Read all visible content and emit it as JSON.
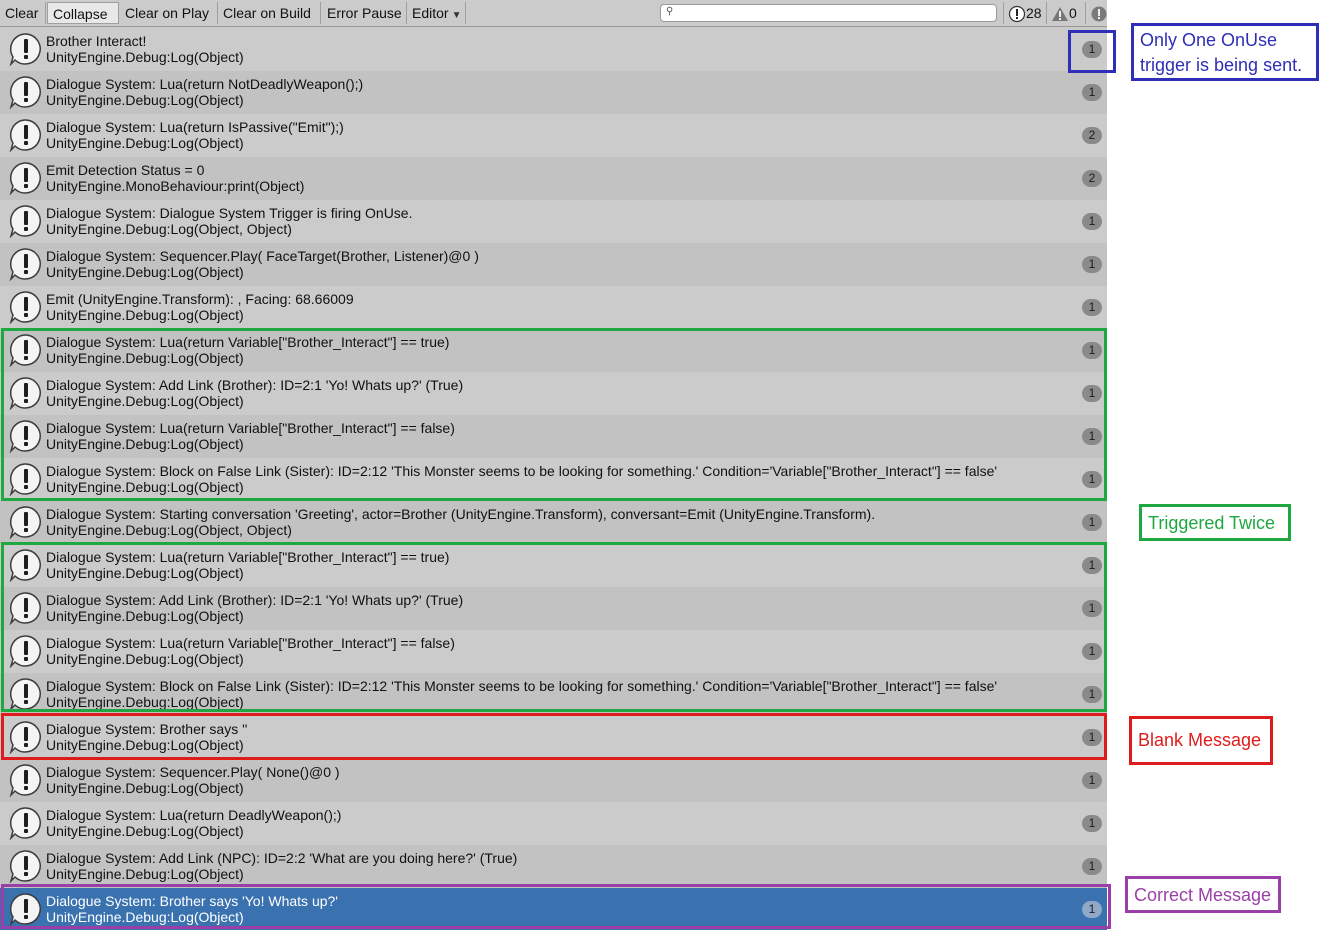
{
  "toolbar": {
    "buttons": [
      {
        "label": "Clear"
      },
      {
        "label": "Collapse"
      },
      {
        "label": "Clear on Play"
      },
      {
        "label": "Clear on Build"
      },
      {
        "label": "Error Pause"
      },
      {
        "label": "Editor"
      }
    ],
    "search": {
      "value": "",
      "placeholder": ""
    },
    "counters": {
      "info": "28",
      "warnings": "0",
      "errors": ""
    }
  },
  "log": [
    {
      "l1": "Brother Interact!",
      "l2": "UnityEngine.Debug:Log(Object)",
      "count": "1"
    },
    {
      "l1": "Dialogue System: Lua(return NotDeadlyWeapon();)",
      "l2": "UnityEngine.Debug:Log(Object)",
      "count": "1"
    },
    {
      "l1": "Dialogue System: Lua(return IsPassive(\"Emit\");)",
      "l2": "UnityEngine.Debug:Log(Object)",
      "count": "2"
    },
    {
      "l1": "Emit Detection Status = 0",
      "l2": "UnityEngine.MonoBehaviour:print(Object)",
      "count": "2"
    },
    {
      "l1": "Dialogue System: Dialogue System Trigger is firing OnUse.",
      "l2": "UnityEngine.Debug:Log(Object, Object)",
      "count": "1"
    },
    {
      "l1": "Dialogue System: Sequencer.Play( FaceTarget(Brother, Listener)@0 )",
      "l2": "UnityEngine.Debug:Log(Object)",
      "count": "1"
    },
    {
      "l1": "Emit (UnityEngine.Transform):  , Facing: 68.66009",
      "l2": "UnityEngine.Debug:Log(Object)",
      "count": "1"
    },
    {
      "l1": "Dialogue System: Lua(return Variable[\"Brother_Interact\"] == true)",
      "l2": "UnityEngine.Debug:Log(Object)",
      "count": "1"
    },
    {
      "l1": "Dialogue System: Add Link (Brother): ID=2:1 'Yo! Whats up?' (True)",
      "l2": "UnityEngine.Debug:Log(Object)",
      "count": "1"
    },
    {
      "l1": "Dialogue System: Lua(return Variable[\"Brother_Interact\"] == false)",
      "l2": "UnityEngine.Debug:Log(Object)",
      "count": "1"
    },
    {
      "l1": "Dialogue System: Block on False Link (Sister): ID=2:12 'This Monster seems to be looking for something.' Condition='Variable[\"Brother_Interact\"] == false'",
      "l2": "UnityEngine.Debug:Log(Object)",
      "count": "1"
    },
    {
      "l1": "Dialogue System: Starting conversation 'Greeting', actor=Brother (UnityEngine.Transform), conversant=Emit (UnityEngine.Transform).",
      "l2": "UnityEngine.Debug:Log(Object, Object)",
      "count": "1"
    },
    {
      "l1": "Dialogue System: Lua(return Variable[\"Brother_Interact\"] == true)",
      "l2": "UnityEngine.Debug:Log(Object)",
      "count": "1"
    },
    {
      "l1": "Dialogue System: Add Link (Brother): ID=2:1 'Yo! Whats up?' (True)",
      "l2": "UnityEngine.Debug:Log(Object)",
      "count": "1"
    },
    {
      "l1": "Dialogue System: Lua(return Variable[\"Brother_Interact\"] == false)",
      "l2": "UnityEngine.Debug:Log(Object)",
      "count": "1"
    },
    {
      "l1": "Dialogue System: Block on False Link (Sister): ID=2:12 'This Monster seems to be looking for something.' Condition='Variable[\"Brother_Interact\"] == false'",
      "l2": "UnityEngine.Debug:Log(Object)",
      "count": "1"
    },
    {
      "l1": "Dialogue System: Brother says ''",
      "l2": "UnityEngine.Debug:Log(Object)",
      "count": "1"
    },
    {
      "l1": "Dialogue System: Sequencer.Play( None()@0 )",
      "l2": "UnityEngine.Debug:Log(Object)",
      "count": "1"
    },
    {
      "l1": "Dialogue System: Lua(return DeadlyWeapon();)",
      "l2": "UnityEngine.Debug:Log(Object)",
      "count": "1"
    },
    {
      "l1": "Dialogue System: Add Link (NPC): ID=2:2 'What are you doing here?' (True)",
      "l2": "UnityEngine.Debug:Log(Object)",
      "count": "1"
    },
    {
      "l1": "Dialogue System: Brother says 'Yo! Whats up?'",
      "l2": "UnityEngine.Debug:Log(Object)",
      "count": "1",
      "selected": true
    }
  ],
  "annotations": {
    "onuse": {
      "line1": "Only One OnUse",
      "line2": "trigger is being sent.",
      "color": "#2e2eb8"
    },
    "twice": {
      "text": "Triggered Twice",
      "color": "#1fa83f"
    },
    "blank": {
      "text": "Blank Message",
      "color": "#e01b1b"
    },
    "correct": {
      "text": "Correct Message",
      "color": "#9b3fa8"
    }
  },
  "colors": {
    "selection": "#3a72b0",
    "row_light": "#cbcbcb",
    "row_dark": "#c2c2c2"
  }
}
